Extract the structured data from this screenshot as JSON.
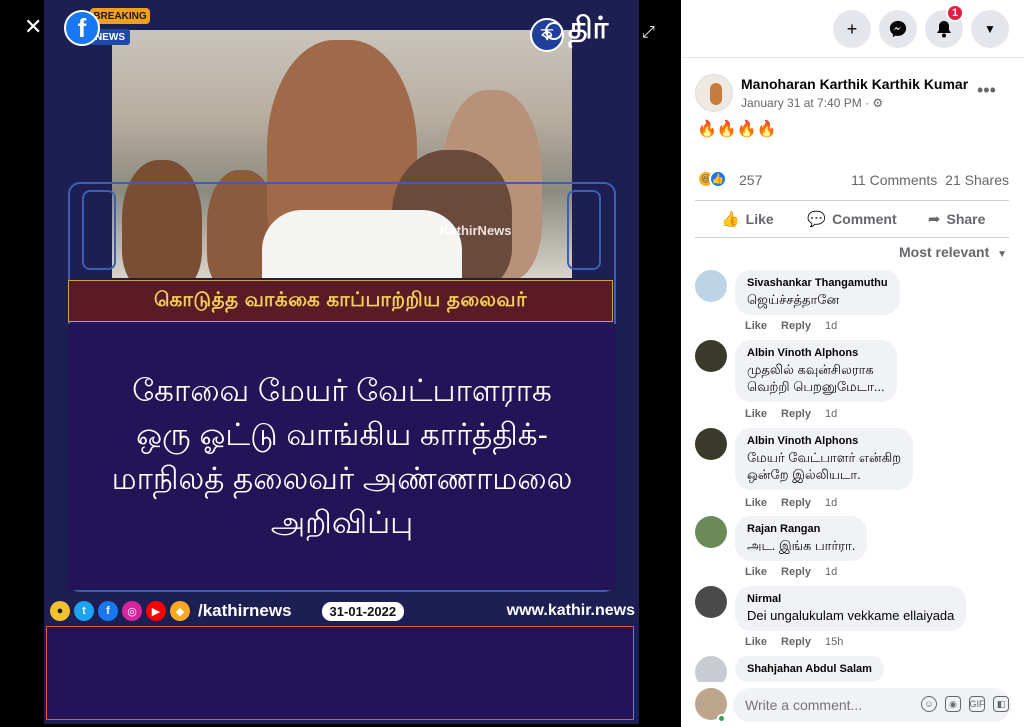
{
  "viewer": {
    "breaking_label": "BREAKING",
    "news_label": "NEWS",
    "fb_letter": "f",
    "brand_text": "திர்",
    "watermark": "KathirNews",
    "headline": "கொடுத்த வாக்கை காப்பாற்றிய தலைவர்",
    "body_lines": [
      "கோவை மேயர் வேட்பாளராக",
      "ஒரு ஓட்டு வாங்கிய கார்த்திக்-",
      "மாநிலத் தலைவர் அண்ணாமலை",
      "அறிவிப்பு"
    ],
    "handle": "/kathirnews",
    "date": "31-01-2022",
    "website": "www.kathir.news",
    "close_icon": "close-icon",
    "expand_icon": "expand-icon",
    "zoom_icon": "zoom-icon"
  },
  "topbar": {
    "notification_count": "1",
    "icons": [
      "plus-icon",
      "messenger-icon",
      "bell-icon",
      "caret-down-icon"
    ]
  },
  "post": {
    "author": "Manoharan Karthik Karthik Kumar",
    "meta": "January 31 at 7:40 PM · ⚙",
    "text": "🔥🔥🔥🔥",
    "reaction_count": "257",
    "comments_label": "11 Comments",
    "shares_label": "21 Shares"
  },
  "actions": {
    "like": "Like",
    "comment": "Comment",
    "share": "Share",
    "sort": "Most relevant"
  },
  "comments": [
    {
      "name": "Sivashankar Thangamuthu",
      "lines": [
        "ஜெய்ச்சத்தானே"
      ],
      "like": "Like",
      "reply": "Reply",
      "time": "1d"
    },
    {
      "name": "Albin Vinoth Alphons",
      "lines": [
        "முதலில் கவுன்சிலராக",
        "வெற்றி பெறனுமேடா..."
      ],
      "like": "Like",
      "reply": "Reply",
      "time": "1d"
    },
    {
      "name": "Albin Vinoth Alphons",
      "lines": [
        "மேயர் வேட்பாளர் என்கிற",
        "ஒன்றே இல்லியடா."
      ],
      "like": "Like",
      "reply": "Reply",
      "time": "1d"
    },
    {
      "name": "Rajan Rangan",
      "lines": [
        "அட. இங்க பார்ரா."
      ],
      "like": "Like",
      "reply": "Reply",
      "time": "1d"
    },
    {
      "name": "Nirmal",
      "lines": [
        "Dei ungalukulam vekkame ellaiyada"
      ],
      "like": "Like",
      "reply": "Reply",
      "time": "15h"
    },
    {
      "name": "Shahjahan Abdul Salam",
      "lines": [],
      "like": "",
      "reply": "",
      "time": ""
    }
  ],
  "composer": {
    "placeholder": "Write a comment..."
  },
  "colors": {
    "facebook_blue": "#1877f2",
    "poster_navy": "#231457",
    "headline_gold": "#f2cf5a",
    "badge_red": "#e41e3f"
  }
}
